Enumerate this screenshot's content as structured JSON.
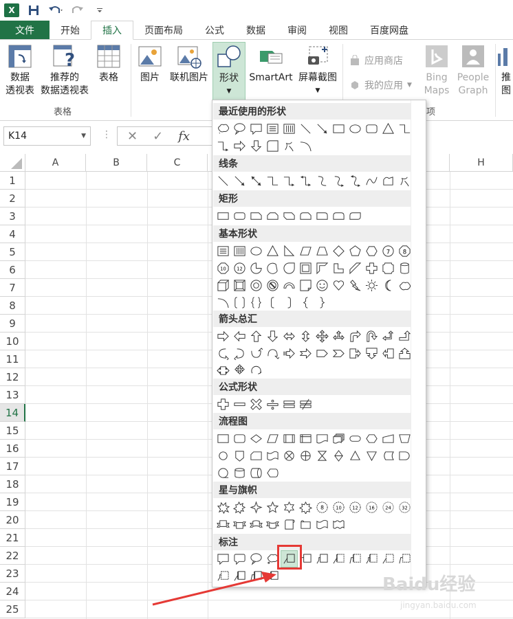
{
  "app": {
    "logo_letter": "X"
  },
  "tabs": [
    "文件",
    "开始",
    "插入",
    "页面布局",
    "公式",
    "数据",
    "审阅",
    "视图",
    "百度网盘"
  ],
  "ribbon": {
    "pivot_table": [
      "数据",
      "透视表"
    ],
    "recommended_pivot": [
      "推荐的",
      "数据透视表"
    ],
    "table": "表格",
    "group_tables": "表格",
    "picture": "图片",
    "online_picture": "联机图片",
    "shapes": "形状",
    "smartart": "SmartArt",
    "screenshot": "屏幕截图",
    "app_store": "应用商店",
    "my_apps": "我的应用",
    "bing_maps": [
      "Bing",
      "Maps"
    ],
    "people_graph": [
      "People",
      "Graph"
    ],
    "recommended_chart_partial": "推",
    "recommended_chart_partial2": "图",
    "group_apps_partial": "项"
  },
  "formula_bar": {
    "name_box": "K14",
    "fx": "fx"
  },
  "grid": {
    "columns": [
      "A",
      "B",
      "C",
      "H"
    ],
    "rows": [
      "1",
      "2",
      "3",
      "4",
      "5",
      "6",
      "7",
      "8",
      "9",
      "10",
      "11",
      "12",
      "13",
      "14",
      "15",
      "16",
      "17",
      "18",
      "19",
      "20",
      "21",
      "22",
      "23",
      "24",
      "25"
    ],
    "selected_row": "14"
  },
  "shapes_menu": {
    "sections": [
      "最近使用的形状",
      "线条",
      "矩形",
      "基本形状",
      "箭头总汇",
      "公式形状",
      "流程图",
      "星与旗帜",
      "标注"
    ]
  },
  "colors": {
    "excel_green": "#217346",
    "highlight": "#cde6d6",
    "annotation_red": "#e53935"
  },
  "watermark": {
    "main": "Baidu经验",
    "sub": "jingyan.baidu.com"
  }
}
